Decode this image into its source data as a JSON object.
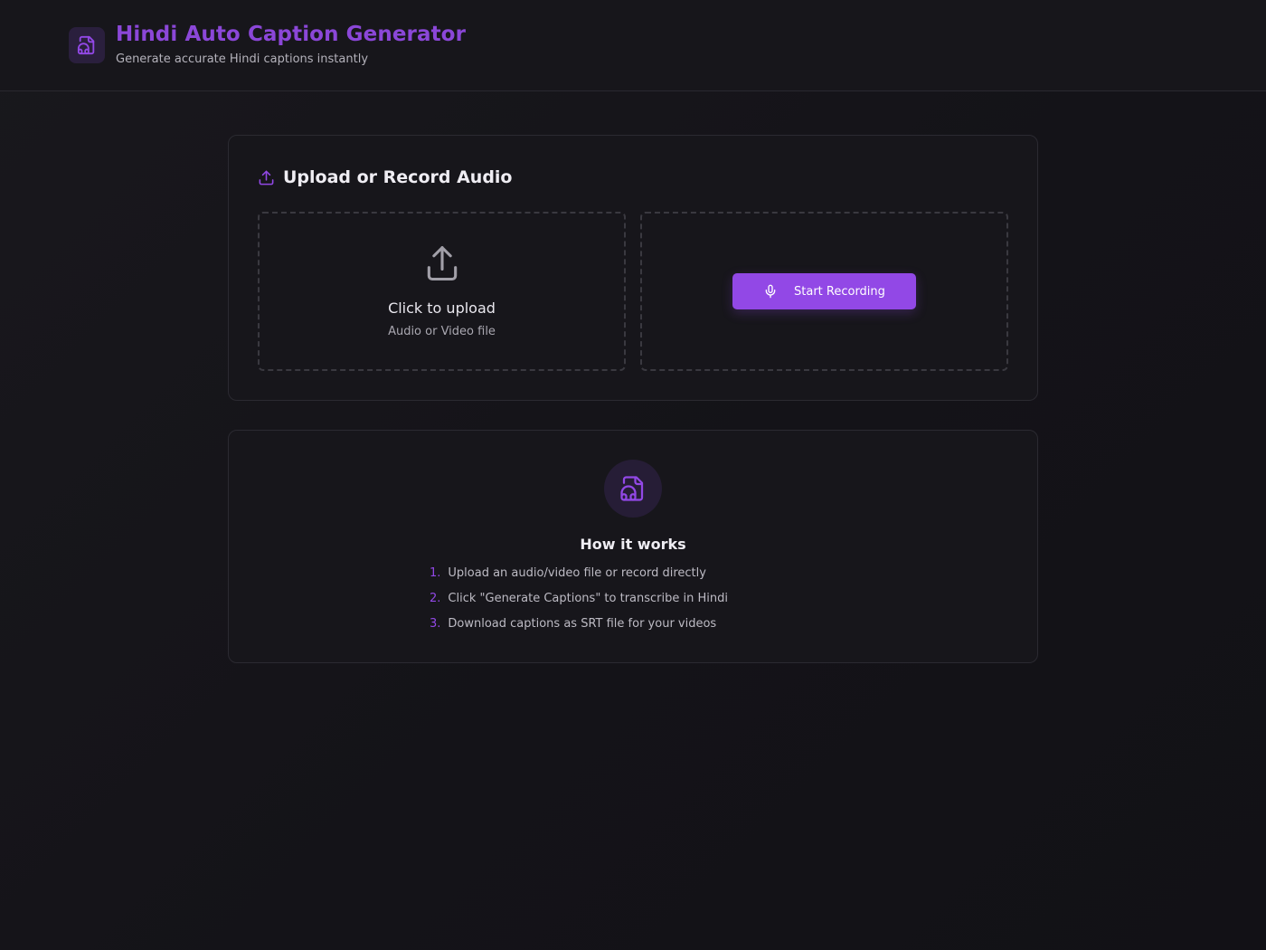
{
  "header": {
    "title": "Hindi Auto Caption Generator",
    "subtitle": "Generate accurate Hindi captions instantly",
    "logo_icon": "audio-file-icon"
  },
  "upload_card": {
    "heading": "Upload or Record Audio",
    "heading_icon": "upload-icon",
    "upload_zone": {
      "icon": "upload-icon",
      "title": "Click to upload",
      "subtitle": "Audio or Video file"
    },
    "record_zone": {
      "button_label": "Start Recording",
      "button_icon": "microphone-icon"
    }
  },
  "how_card": {
    "icon": "audio-file-icon",
    "title": "How it works",
    "steps": [
      {
        "num": "1.",
        "text": "Upload an audio/video file or record directly"
      },
      {
        "num": "2.",
        "text": "Click \"Generate Captions\" to transcribe in Hindi"
      },
      {
        "num": "3.",
        "text": "Download captions as SRT file for your videos"
      }
    ]
  },
  "colors": {
    "accent": "#9248e6",
    "title": "#8b47d8",
    "background": "#141318",
    "card": "#17161b"
  }
}
